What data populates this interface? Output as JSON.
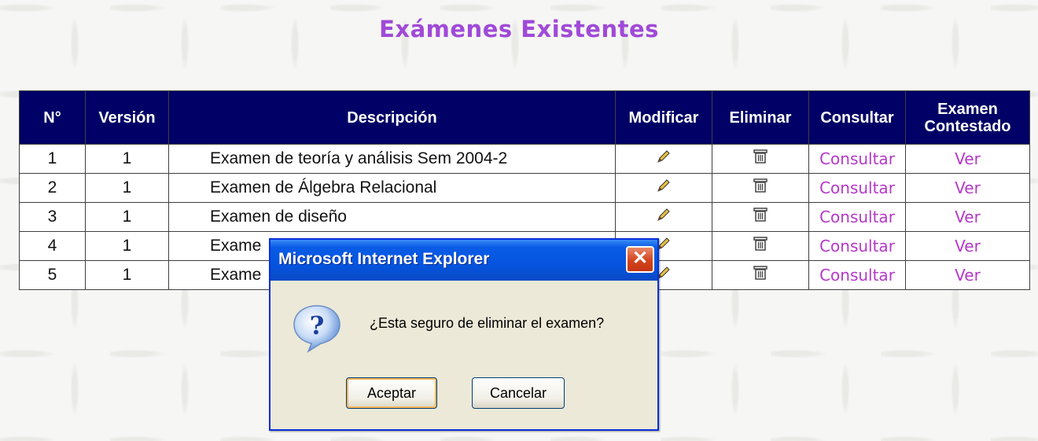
{
  "page": {
    "title": "Exámenes Existentes"
  },
  "table": {
    "headers": {
      "num": "N°",
      "version": "Versión",
      "description": "Descripción",
      "modify": "Modificar",
      "delete": "Eliminar",
      "consult": "Consultar",
      "answered_line1": "Examen",
      "answered_line2": "Contestado"
    },
    "rows": [
      {
        "num": "1",
        "version": "1",
        "description": "Examen de teoría y análisis Sem 2004-2",
        "consult": "Consultar",
        "answered": "Ver"
      },
      {
        "num": "2",
        "version": "1",
        "description": "Examen de Álgebra Relacional",
        "consult": "Consultar",
        "answered": "Ver"
      },
      {
        "num": "3",
        "version": "1",
        "description": "Examen de diseño",
        "consult": "Consultar",
        "answered": "Ver"
      },
      {
        "num": "4",
        "version": "1",
        "description": "Exame",
        "consult": "Consultar",
        "answered": "Ver"
      },
      {
        "num": "5",
        "version": "1",
        "description": "Exame",
        "consult": "Consultar",
        "answered": "Ver"
      }
    ],
    "modify_icon": "pencil-icon",
    "delete_icon": "trash-icon"
  },
  "dialog": {
    "title": "Microsoft Internet Explorer",
    "message": "¿Esta seguro de eliminar el examen?",
    "ok_label": "Aceptar",
    "cancel_label": "Cancelar",
    "close_glyph": "✕",
    "icon": "question-icon"
  },
  "colors": {
    "title": "#a04ad8",
    "header_bg": "#000066",
    "link": "#b638c9",
    "dialog_titlebar": "#0454e0"
  }
}
